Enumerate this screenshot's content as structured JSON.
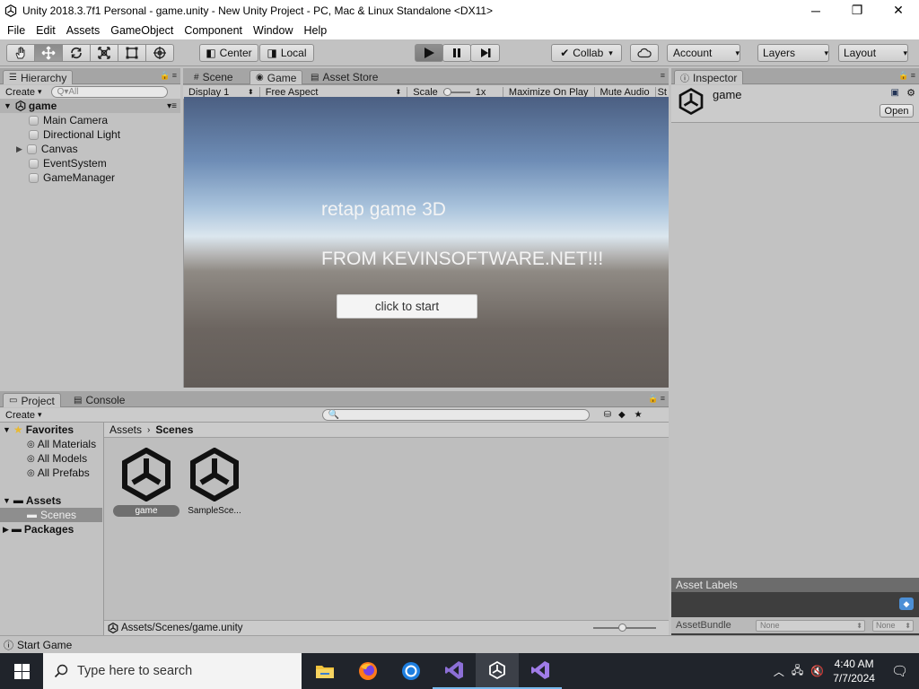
{
  "window": {
    "title": "Unity 2018.3.7f1 Personal - game.unity - New Unity Project - PC, Mac & Linux Standalone <DX11>",
    "minimize": "─",
    "restore": "❐",
    "close": "✕"
  },
  "menu": [
    "File",
    "Edit",
    "Assets",
    "GameObject",
    "Component",
    "Window",
    "Help"
  ],
  "toolbar": {
    "pivot": "Center",
    "space": "Local",
    "collab": "Collab",
    "account": "Account",
    "layers": "Layers",
    "layout": "Layout"
  },
  "hierarchy": {
    "tab": "Hierarchy",
    "create": "Create",
    "search_placeholder": "Q▾All",
    "scene": "game",
    "items": [
      {
        "label": "Main Camera",
        "expandable": false
      },
      {
        "label": "Directional Light",
        "expandable": false
      },
      {
        "label": "Canvas",
        "expandable": true
      },
      {
        "label": "EventSystem",
        "expandable": false
      },
      {
        "label": "GameManager",
        "expandable": false
      }
    ]
  },
  "view_tabs": {
    "scene": "Scene",
    "game": "Game",
    "asset_store": "Asset Store"
  },
  "game_bar": {
    "display": "Display 1",
    "aspect": "Free Aspect",
    "scale_label": "Scale",
    "scale_value": "1x",
    "maximize": "Maximize On Play",
    "mute": "Mute Audio",
    "stats": "St"
  },
  "game_view": {
    "title": "retap game 3D",
    "subtitle": "FROM KEVINSOFTWARE.NET!!!",
    "button": "click to start"
  },
  "inspector": {
    "tab": "Inspector",
    "name": "game",
    "open": "Open",
    "labels_title": "Asset Labels",
    "bundle_label": "AssetBundle",
    "bundle_value": "None",
    "variant_value": "None"
  },
  "project": {
    "tab": "Project",
    "console_tab": "Console",
    "create": "Create",
    "favorites_title": "Favorites",
    "favorites": [
      "All Materials",
      "All Models",
      "All Prefabs"
    ],
    "assets_title": "Assets",
    "folders": [
      "Scenes"
    ],
    "packages_title": "Packages",
    "breadcrumb": [
      "Assets",
      "Scenes"
    ],
    "files": [
      "game",
      "SampleSce..."
    ],
    "path": "Assets/Scenes/game.unity"
  },
  "status": {
    "text": "Start Game"
  },
  "taskbar": {
    "search_placeholder": "Type here to search",
    "time": "4:40 AM",
    "date": "7/7/2024"
  }
}
